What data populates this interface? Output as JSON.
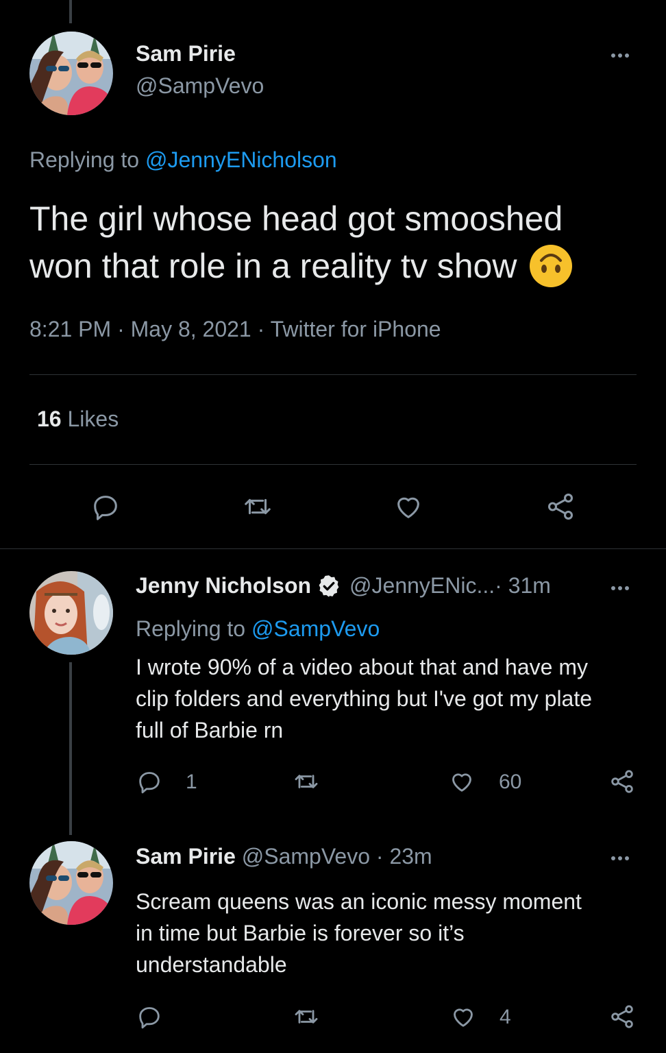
{
  "main_tweet": {
    "author_name": "Sam Pirie",
    "author_handle": "@SampVevo",
    "replying_prefix": "Replying to ",
    "replying_to": "@JennyENicholson",
    "text_line1": "The girl whose head got smooshed",
    "text_line2": "won that role in a reality tv show",
    "emoji": "upside-down-face",
    "meta": "8:21 PM · May 8, 2021 · Twitter for iPhone",
    "likes_count": "16",
    "likes_label": " Likes"
  },
  "replies": [
    {
      "author_name": "Jenny Nicholson",
      "verified": true,
      "author_handle": "@JennyENic...",
      "time": " · 31m",
      "replying_prefix": "Replying to ",
      "replying_to": "@SampVevo",
      "text_lines": [
        "I wrote 90% of a video about that and have my",
        "clip folders and everything but I've got my plate",
        "full of Barbie rn"
      ],
      "reply_count": "1",
      "retweet_count": "",
      "like_count": "60"
    },
    {
      "author_name": "Sam Pirie",
      "author_handle": "@SampVevo",
      "time": " · 23m",
      "text_lines": [
        "Scream queens was an iconic messy moment",
        "in time but Barbie is forever so it’s",
        "understandable"
      ],
      "reply_count": "",
      "retweet_count": "",
      "like_count": "4"
    }
  ],
  "colors": {
    "background": "#000000",
    "text": "#e7e9ea",
    "muted": "#8b98a5",
    "link": "#1d9bf0",
    "divider": "#2f3336",
    "emoji": "#f7c12b"
  },
  "icons": [
    "reply-icon",
    "retweet-icon",
    "like-icon",
    "share-icon",
    "more-icon",
    "verified-icon"
  ]
}
